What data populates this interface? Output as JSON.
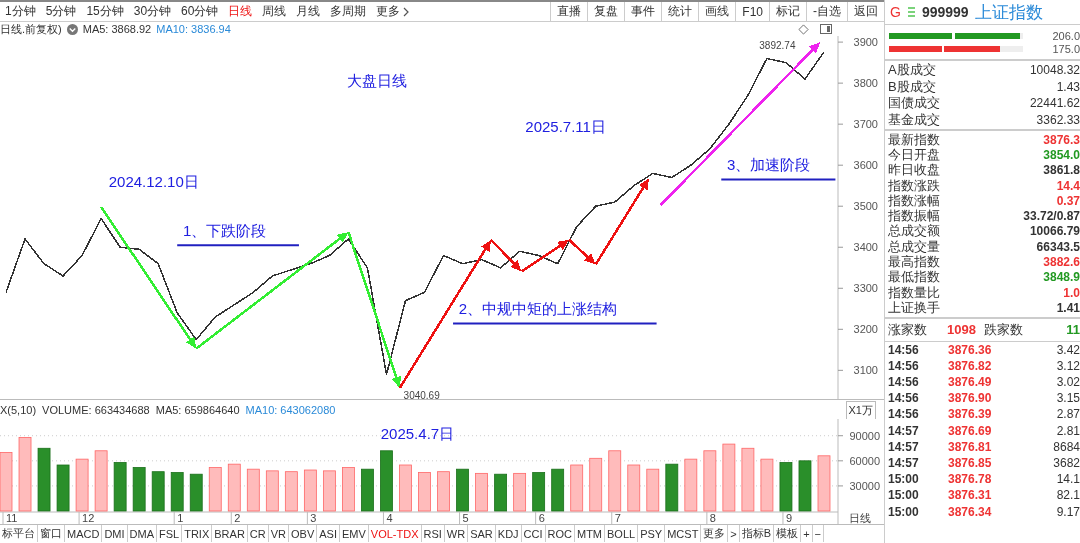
{
  "period_tabs": [
    {
      "label": "1分钟",
      "selected": false
    },
    {
      "label": "5分钟",
      "selected": false
    },
    {
      "label": "15分钟",
      "selected": false
    },
    {
      "label": "30分钟",
      "selected": false
    },
    {
      "label": "60分钟",
      "selected": false
    },
    {
      "label": "日线",
      "selected": true
    },
    {
      "label": "周线",
      "selected": false
    },
    {
      "label": "月线",
      "selected": false
    },
    {
      "label": "多周期",
      "selected": false
    },
    {
      "label": "更多",
      "selected": false,
      "kind": "more"
    }
  ],
  "toolbar_buttons": [
    "直播",
    "复盘",
    "事件",
    "统计",
    "画线",
    "F10",
    "标记",
    "-自选",
    "返回"
  ],
  "price_header": {
    "title": "日线.前复权)",
    "ma5": "MA5: 3868.92",
    "ma10": "MA10: 3836.94"
  },
  "price_chart": {
    "chart_data": {
      "type": "line",
      "categories": [
        null,
        null,
        null,
        null,
        null,
        null,
        null,
        null,
        null,
        null,
        null,
        null,
        null,
        null,
        null,
        null,
        null,
        null,
        null,
        null,
        null,
        null,
        null,
        null,
        null,
        null,
        null,
        null,
        null,
        null,
        null,
        null,
        null,
        null,
        null,
        null,
        null,
        null,
        null,
        null,
        null,
        null,
        null,
        null
      ],
      "ylim": [
        3035,
        3910
      ],
      "yticks": [
        3100,
        3200,
        3300,
        3400,
        3500,
        3600,
        3700,
        3800,
        3900
      ],
      "series": [
        {
          "color": "#333333",
          "values": [
            3290,
            3420,
            3360,
            3330,
            3380,
            3470,
            3400,
            3395,
            3360,
            3240,
            3175,
            3230,
            3260,
            3290,
            3330,
            3345,
            3360,
            3380,
            3420,
            3350,
            3090,
            3270,
            3290,
            3380,
            3360,
            3370,
            3350,
            3390,
            3380,
            3360,
            3450,
            3500,
            3510,
            3550,
            3580,
            3570,
            3600,
            3640,
            3700,
            3770,
            3860,
            3850,
            3810,
            3876
          ]
        }
      ]
    },
    "overlays": [
      {
        "kind": "text",
        "text": "大盘日线"
      },
      {
        "kind": "text",
        "text": "2024.12.10日"
      },
      {
        "kind": "text",
        "text": "1、下跌阶段"
      },
      {
        "kind": "text",
        "text": "2025.7.11日"
      },
      {
        "kind": "text",
        "text": "2、中规中矩的上涨结构"
      },
      {
        "kind": "text",
        "text": "3、加速阶段"
      },
      {
        "kind": "value_label",
        "text": "3892.74"
      },
      {
        "kind": "value_label",
        "text": "3040.69"
      },
      {
        "kind": "arrow",
        "color": "#33ee33"
      },
      {
        "kind": "arrow",
        "color": "#33ee33"
      },
      {
        "kind": "arrow",
        "color": "#33ee33"
      },
      {
        "kind": "arrow",
        "color": "#ee1111"
      },
      {
        "kind": "arrow",
        "color": "#ee1111"
      },
      {
        "kind": "arrow",
        "color": "#ee1111"
      },
      {
        "kind": "arrow",
        "color": "#ee1111"
      },
      {
        "kind": "arrow",
        "color": "#ee1111"
      },
      {
        "kind": "arrow",
        "color": "#ee22ee"
      },
      {
        "kind": "underline"
      },
      {
        "kind": "underline"
      },
      {
        "kind": "underline"
      }
    ]
  },
  "volume_header": {
    "title": "X(5,10)",
    "volume": "VOLUME: 663434688",
    "ma5": "MA5: 659864640",
    "ma10": "MA10: 643062080"
  },
  "volume_chart": {
    "unit": "X1万",
    "period": "日线",
    "chart_data": {
      "type": "bar",
      "grid": true,
      "ylim": [
        0,
        110000
      ],
      "yticks": [
        30000,
        60000,
        90000
      ],
      "categories": [
        "11",
        null,
        null,
        null,
        "12",
        null,
        null,
        null,
        null,
        "1",
        null,
        null,
        "2",
        null,
        null,
        null,
        "3",
        null,
        null,
        null,
        "4",
        null,
        null,
        null,
        "5",
        null,
        null,
        null,
        "6",
        null,
        null,
        null,
        "7",
        null,
        null,
        null,
        null,
        "8",
        null,
        null,
        null,
        "9",
        null,
        null
      ],
      "values": [
        70000,
        88000,
        75000,
        55000,
        62000,
        72000,
        58000,
        52000,
        47000,
        46000,
        44000,
        52000,
        56000,
        50000,
        48000,
        47000,
        49000,
        48000,
        52000,
        50000,
        72000,
        55000,
        46000,
        47000,
        50000,
        45000,
        44000,
        45000,
        46000,
        50000,
        55000,
        63000,
        72000,
        55000,
        50000,
        56000,
        62000,
        72000,
        80000,
        75000,
        62000,
        58000,
        60000,
        66000
      ]
    },
    "overlays": [
      {
        "kind": "text",
        "text": "2025.4.7日"
      }
    ]
  },
  "indicator_tabs": [
    {
      "label": "标平台",
      "selected": false
    },
    {
      "label": "窗口",
      "selected": false
    },
    {
      "label": "MACD",
      "selected": false
    },
    {
      "label": "DMI",
      "selected": false
    },
    {
      "label": "DMA",
      "selected": false
    },
    {
      "label": "FSL",
      "selected": false
    },
    {
      "label": "TRIX",
      "selected": false
    },
    {
      "label": "BRAR",
      "selected": false
    },
    {
      "label": "CR",
      "selected": false
    },
    {
      "label": "VR",
      "selected": false
    },
    {
      "label": "OBV",
      "selected": false
    },
    {
      "label": "ASI",
      "selected": false
    },
    {
      "label": "EMV",
      "selected": false
    },
    {
      "label": "VOL-TDX",
      "selected": true
    },
    {
      "label": "RSI",
      "selected": false
    },
    {
      "label": "WR",
      "selected": false
    },
    {
      "label": "SAR",
      "selected": false
    },
    {
      "label": "KDJ",
      "selected": false
    },
    {
      "label": "CCI",
      "selected": false
    },
    {
      "label": "ROC",
      "selected": false
    },
    {
      "label": "MTM",
      "selected": false
    },
    {
      "label": "BOLL",
      "selected": false
    },
    {
      "label": "PSY",
      "selected": false
    },
    {
      "label": "MCST",
      "selected": false
    },
    {
      "label": "更多",
      "selected": false
    },
    {
      "label": ">",
      "selected": false
    },
    {
      "label": "指标B",
      "selected": false
    },
    {
      "label": "模板",
      "selected": false
    },
    {
      "label": "+",
      "selected": false
    },
    {
      "label": "−",
      "selected": false
    }
  ],
  "quote": {
    "badge": "G",
    "code": "999999",
    "name": "上证指数",
    "bars": [
      {
        "color": "#229922",
        "level": 0.98,
        "value": "206.0"
      },
      {
        "color": "#ee3333",
        "level": 0.83,
        "value": "175.0"
      }
    ],
    "turnover": [
      {
        "label": "A股成交",
        "value": "10048.32"
      },
      {
        "label": "B股成交",
        "value": "1.43"
      },
      {
        "label": "国债成交",
        "value": "22441.62"
      },
      {
        "label": "基金成交",
        "value": "3362.33"
      }
    ],
    "stats": [
      {
        "label": "最新指数",
        "value": "3876.3",
        "color": "#ee3333"
      },
      {
        "label": "今日开盘",
        "value": "3854.0",
        "color": "#229922"
      },
      {
        "label": "昨日收盘",
        "value": "3861.8",
        "color": "#333333"
      },
      {
        "label": "指数涨跌",
        "value": "14.4",
        "color": "#ee3333"
      },
      {
        "label": "指数涨幅",
        "value": "0.37",
        "color": "#ee3333"
      },
      {
        "label": "指数振幅",
        "value": "33.72/0.87",
        "color": "#333333"
      },
      {
        "label": "总成交额",
        "value": "10066.79",
        "color": "#333333"
      },
      {
        "label": "总成交量",
        "value": "66343.5",
        "color": "#333333"
      },
      {
        "label": "最高指数",
        "value": "3882.6",
        "color": "#ee3333"
      },
      {
        "label": "最低指数",
        "value": "3848.9",
        "color": "#229922"
      },
      {
        "label": "指数量比",
        "value": "1.0",
        "color": "#ee3333"
      },
      {
        "label": "上证换手",
        "value": "1.41",
        "color": "#333333"
      }
    ],
    "breadth": {
      "up_label": "涨家数",
      "up_count": "1098",
      "down_label": "跌家数",
      "down_count": "11"
    },
    "ticks": [
      {
        "time": "14:56",
        "price": "3876.36",
        "color": "#ee3333",
        "volume": "3.42"
      },
      {
        "time": "14:56",
        "price": "3876.82",
        "color": "#ee3333",
        "volume": "3.12"
      },
      {
        "time": "14:56",
        "price": "3876.49",
        "color": "#ee3333",
        "volume": "3.02"
      },
      {
        "time": "14:56",
        "price": "3876.90",
        "color": "#ee3333",
        "volume": "3.15"
      },
      {
        "time": "14:56",
        "price": "3876.39",
        "color": "#ee3333",
        "volume": "2.87"
      },
      {
        "time": "14:57",
        "price": "3876.69",
        "color": "#ee3333",
        "volume": "2.81"
      },
      {
        "time": "14:57",
        "price": "3876.81",
        "color": "#ee3333",
        "volume": "8684"
      },
      {
        "time": "14:57",
        "price": "3876.85",
        "color": "#ee3333",
        "volume": "3682"
      },
      {
        "time": "15:00",
        "price": "3876.78",
        "color": "#ee3333",
        "volume": "14.1"
      },
      {
        "time": "15:00",
        "price": "3876.31",
        "color": "#ee3333",
        "volume": "82.1"
      },
      {
        "time": "15:00",
        "price": "3876.34",
        "color": "#ee3333",
        "volume": "9.17"
      }
    ]
  }
}
